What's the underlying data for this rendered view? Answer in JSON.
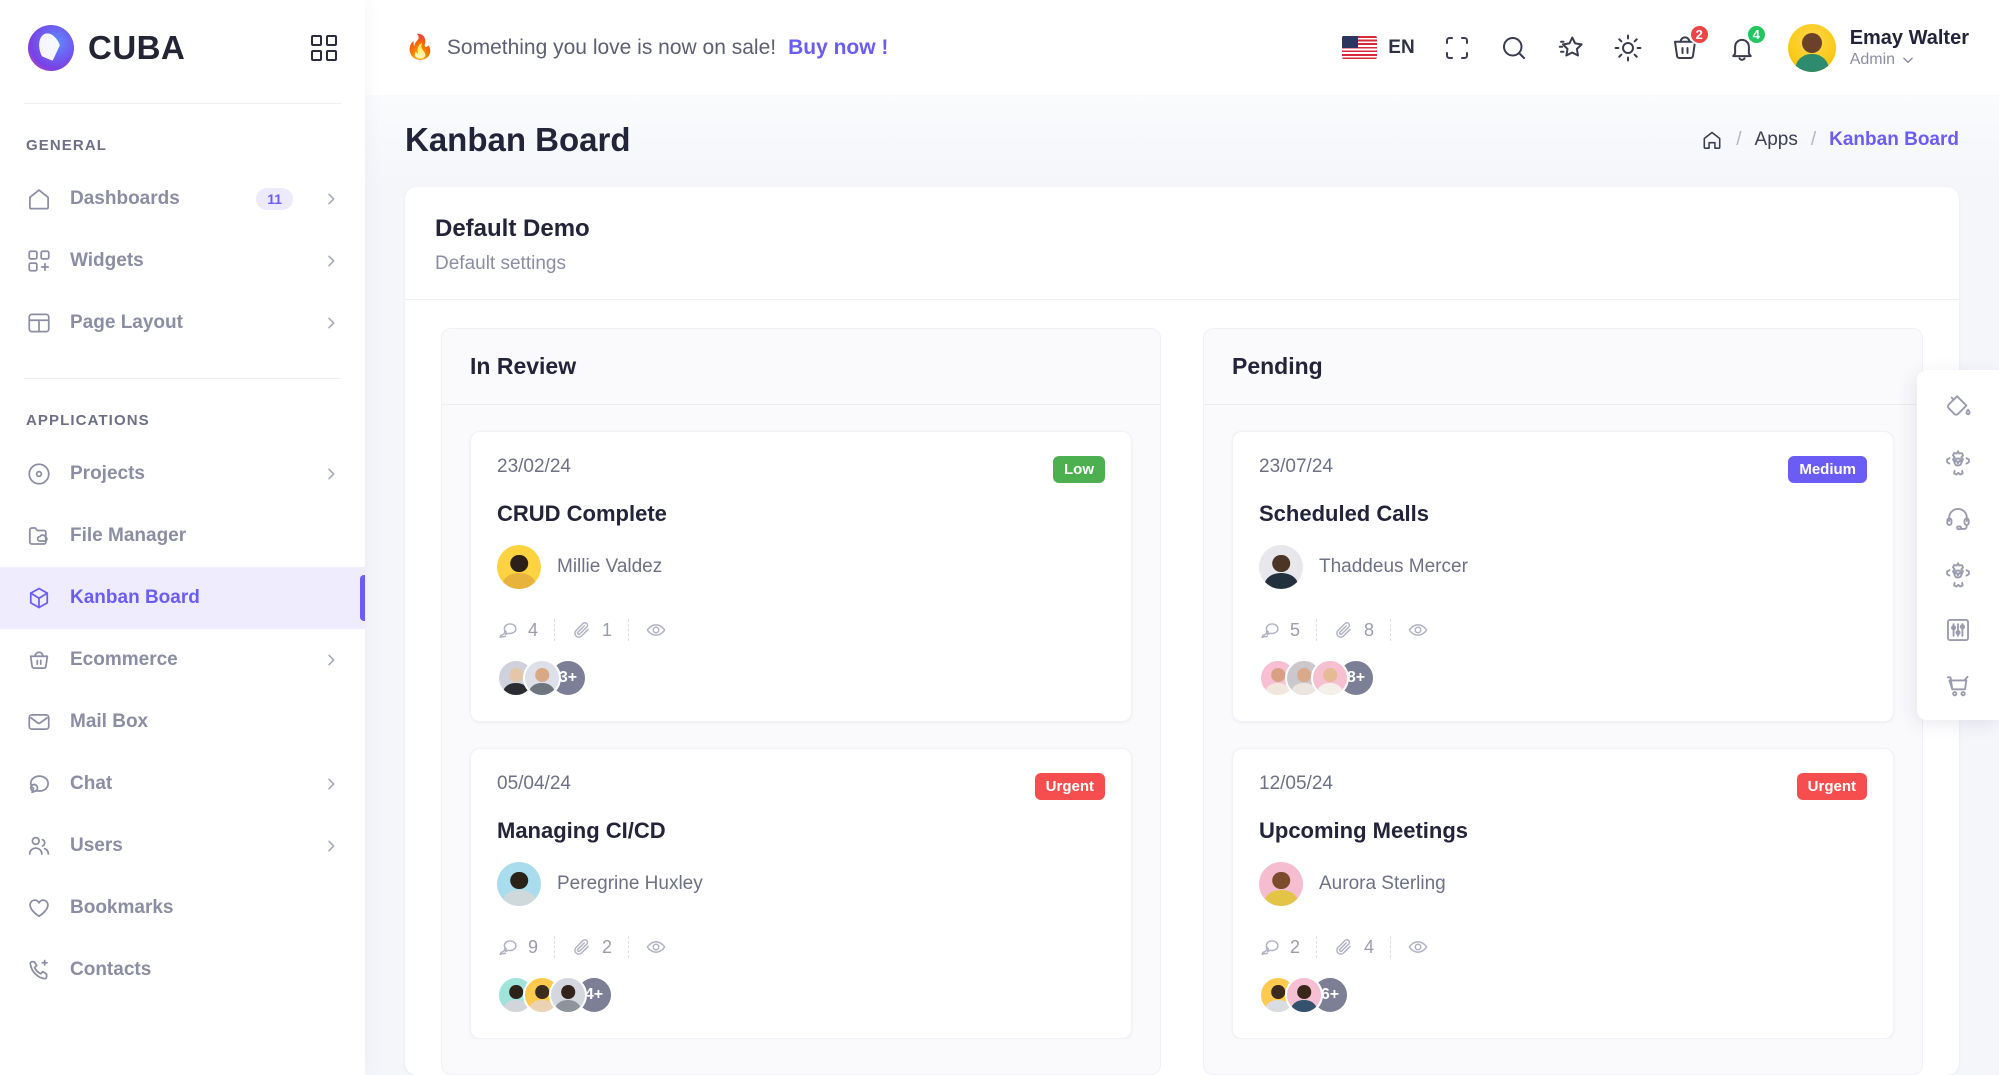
{
  "brand": {
    "name": "CUBA",
    "logo_icon": "cuba-logo-icon",
    "grid_toggle_icon": "grid-toggle-icon"
  },
  "sidebar": {
    "sections": [
      {
        "label": "GENERAL",
        "items": [
          {
            "label": "Dashboards",
            "icon": "home-icon",
            "badge": "11",
            "chevron": true,
            "active": false
          },
          {
            "label": "Widgets",
            "icon": "widgets-icon",
            "badge": "",
            "chevron": true,
            "active": false
          },
          {
            "label": "Page Layout",
            "icon": "layout-icon",
            "badge": "",
            "chevron": true,
            "active": false
          }
        ]
      },
      {
        "label": "APPLICATIONS",
        "items": [
          {
            "label": "Projects",
            "icon": "target-icon",
            "badge": "",
            "chevron": true,
            "active": false
          },
          {
            "label": "File Manager",
            "icon": "folder-cloud-icon",
            "badge": "",
            "chevron": false,
            "active": false
          },
          {
            "label": "Kanban Board",
            "icon": "cube-icon",
            "badge": "",
            "chevron": false,
            "active": true
          },
          {
            "label": "Ecommerce",
            "icon": "basket-icon",
            "badge": "",
            "chevron": true,
            "active": false
          },
          {
            "label": "Mail Box",
            "icon": "envelope-icon",
            "badge": "",
            "chevron": false,
            "active": false
          },
          {
            "label": "Chat",
            "icon": "chat-icon",
            "badge": "",
            "chevron": true,
            "active": false
          },
          {
            "label": "Users",
            "icon": "users-icon",
            "badge": "",
            "chevron": true,
            "active": false
          },
          {
            "label": "Bookmarks",
            "icon": "heart-icon",
            "badge": "",
            "chevron": false,
            "active": false
          },
          {
            "label": "Contacts",
            "icon": "phone-add-icon",
            "badge": "",
            "chevron": false,
            "active": false
          }
        ]
      }
    ]
  },
  "topbar": {
    "promo_emoji": "🔥",
    "promo_text": "Something you love is now on sale!",
    "promo_link": "Buy now !",
    "language": {
      "code": "EN",
      "flag_icon": "us-flag-icon"
    },
    "icons": [
      {
        "name": "scan-icon",
        "badge": "",
        "badge_color": ""
      },
      {
        "name": "search-icon",
        "badge": "",
        "badge_color": ""
      },
      {
        "name": "star-icon",
        "badge": "",
        "badge_color": ""
      },
      {
        "name": "sun-icon",
        "badge": "",
        "badge_color": ""
      },
      {
        "name": "cart-icon",
        "badge": "2",
        "badge_color": "#ef4444"
      },
      {
        "name": "bell-icon",
        "badge": "4",
        "badge_color": "#22c55e"
      }
    ],
    "user": {
      "name": "Emay Walter",
      "role": "Admin",
      "chevron_icon": "chevron-down-icon"
    }
  },
  "page": {
    "title": "Kanban Board",
    "breadcrumb": {
      "home_icon": "home-icon",
      "items": [
        "Apps",
        "Kanban Board"
      ],
      "separator": "/"
    }
  },
  "panel": {
    "title": "Default Demo",
    "subtitle": "Default settings"
  },
  "board": {
    "columns": [
      {
        "title": "In Review",
        "cards": [
          {
            "date": "23/02/24",
            "priority": {
              "label": "Low",
              "color": "#4caf50"
            },
            "title": "CRUD Complete",
            "assignee": {
              "name": "Millie Valdez",
              "avatar_bg": "#ffd23f",
              "head": "#2b2118",
              "body": "#e8b33c"
            },
            "comments": "4",
            "attachments": "1",
            "views": "",
            "members_more": "3+",
            "members": [
              {
                "bg": "#cfd2dc",
                "head": "#e6c6a8",
                "body": "#2b2b33"
              },
              {
                "bg": "#dde0e8",
                "head": "#d9a985",
                "body": "#6e757f"
              }
            ]
          },
          {
            "date": "05/04/24",
            "priority": {
              "label": "Urgent",
              "color": "#f64e4e"
            },
            "title": "Managing CI/CD",
            "assignee": {
              "name": "Peregrine Huxley",
              "avatar_bg": "#a9ddee",
              "head": "#2a2119",
              "body": "#cfd8da"
            },
            "comments": "9",
            "attachments": "2",
            "views": "",
            "members_more": "4+",
            "members": [
              {
                "bg": "#9fe3da",
                "head": "#2d2118",
                "body": "#d2d6db"
              },
              {
                "bg": "#ffc94d",
                "head": "#3a2b1e",
                "body": "#ecd2b5"
              },
              {
                "bg": "#d5d7de",
                "head": "#32241a",
                "body": "#8d949c"
              }
            ]
          }
        ]
      },
      {
        "title": "Pending",
        "cards": [
          {
            "date": "23/07/24",
            "priority": {
              "label": "Medium",
              "color": "#6a5cf5"
            },
            "title": "Scheduled Calls",
            "assignee": {
              "name": "Thaddeus Mercer",
              "avatar_bg": "#e7e7ec",
              "head": "#4a3527",
              "body": "#23313f"
            },
            "comments": "5",
            "attachments": "8",
            "views": "",
            "members_more": "8+",
            "members": [
              {
                "bg": "#f8bfd2",
                "head": "#d9a184",
                "body": "#f2e7de"
              },
              {
                "bg": "#ccc7cb",
                "head": "#d8a98a",
                "body": "#ece5e0"
              },
              {
                "bg": "#f7c0d1",
                "head": "#e4bb94",
                "body": "#f5efe9"
              }
            ]
          },
          {
            "date": "12/05/24",
            "priority": {
              "label": "Urgent",
              "color": "#f64e4e"
            },
            "title": "Upcoming Meetings",
            "assignee": {
              "name": "Aurora Sterling",
              "avatar_bg": "#f6bcd0",
              "head": "#7c4a2c",
              "body": "#e4c444"
            },
            "comments": "2",
            "attachments": "4",
            "views": "",
            "members_more": "6+",
            "members": [
              {
                "bg": "#ffca4f",
                "head": "#3b2a1d",
                "body": "#d9dde2"
              },
              {
                "bg": "#f7bfd3",
                "head": "#39271b",
                "body": "#34516e"
              }
            ]
          }
        ]
      }
    ]
  },
  "float_toolbar": {
    "items": [
      {
        "name": "paint-bucket-icon"
      },
      {
        "name": "gear-icon"
      },
      {
        "name": "headset-icon"
      },
      {
        "name": "settings-gear-icon"
      },
      {
        "name": "sliders-icon"
      },
      {
        "name": "shopping-cart-icon"
      }
    ]
  },
  "colors": {
    "accent": "#6a5cf5",
    "accent_soft": "#eeecfd",
    "text": "#23243a",
    "muted": "#8b8da3"
  }
}
